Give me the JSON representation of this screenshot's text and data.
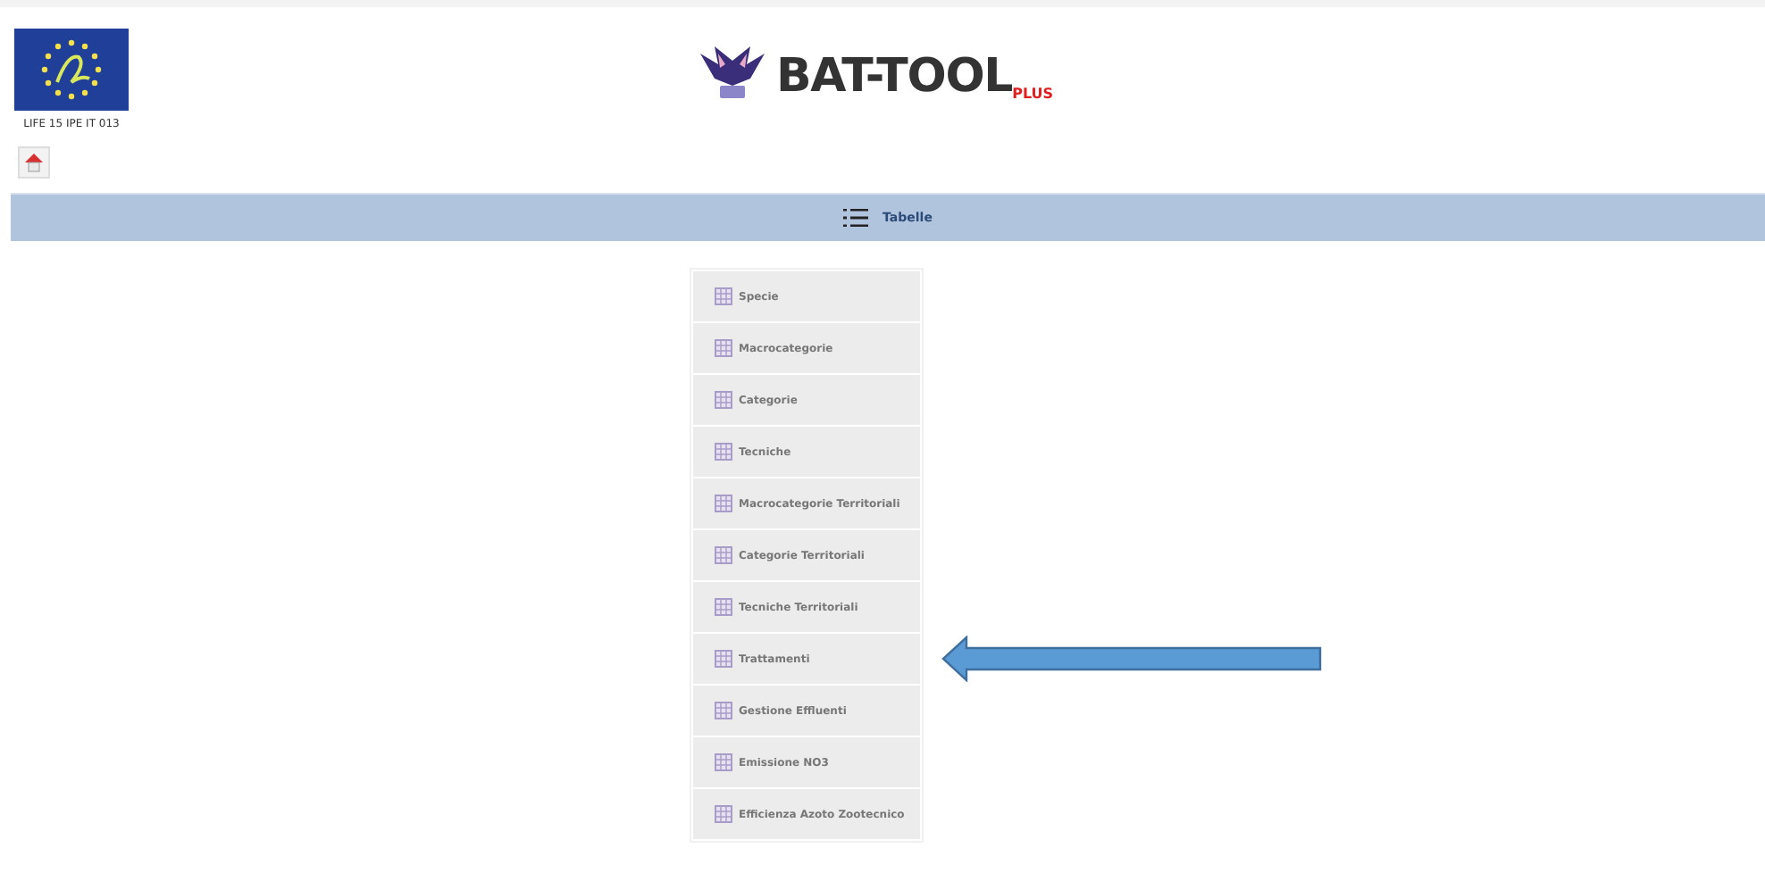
{
  "header": {
    "project_code": "LIFE 15 IPE IT 013",
    "logo_title": "BAT-TOOL",
    "logo_suffix": "PLUS"
  },
  "nav_bar": {
    "label": "Tabelle"
  },
  "menu_items": [
    {
      "label": "Specie"
    },
    {
      "label": "Macrocategorie"
    },
    {
      "label": "Categorie"
    },
    {
      "label": "Tecniche"
    },
    {
      "label": "Macrocategorie Territoriali"
    },
    {
      "label": "Categorie Territoriali"
    },
    {
      "label": "Tecniche Territoriali"
    },
    {
      "label": "Trattamenti",
      "pointed": true
    },
    {
      "label": "Gestione Effluenti"
    },
    {
      "label": "Emissione NO3"
    },
    {
      "label": "Efficienza Azoto Zootecnico"
    }
  ]
}
